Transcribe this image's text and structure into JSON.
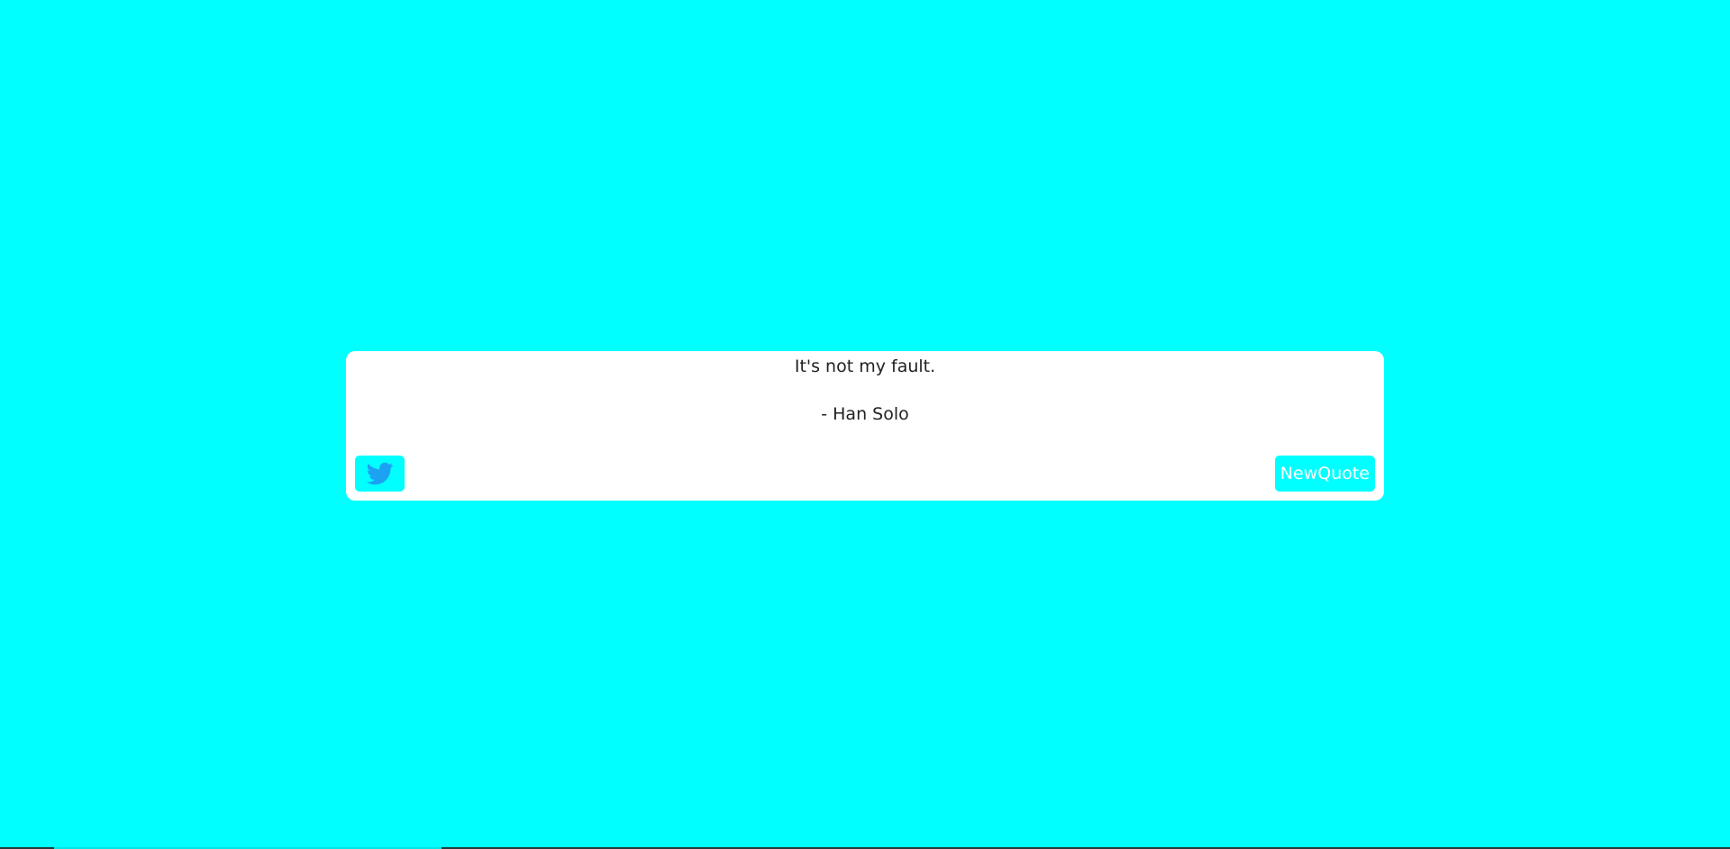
{
  "page": {
    "background_color": "#00ffff"
  },
  "quote": {
    "text": "It's not my fault.",
    "author": "- Han Solo"
  },
  "actions": {
    "tweet_icon": "twitter-bird-icon",
    "new_quote_label": "NewQuote",
    "button_color": "#00ffff",
    "icon_color": "#1da1f2"
  }
}
